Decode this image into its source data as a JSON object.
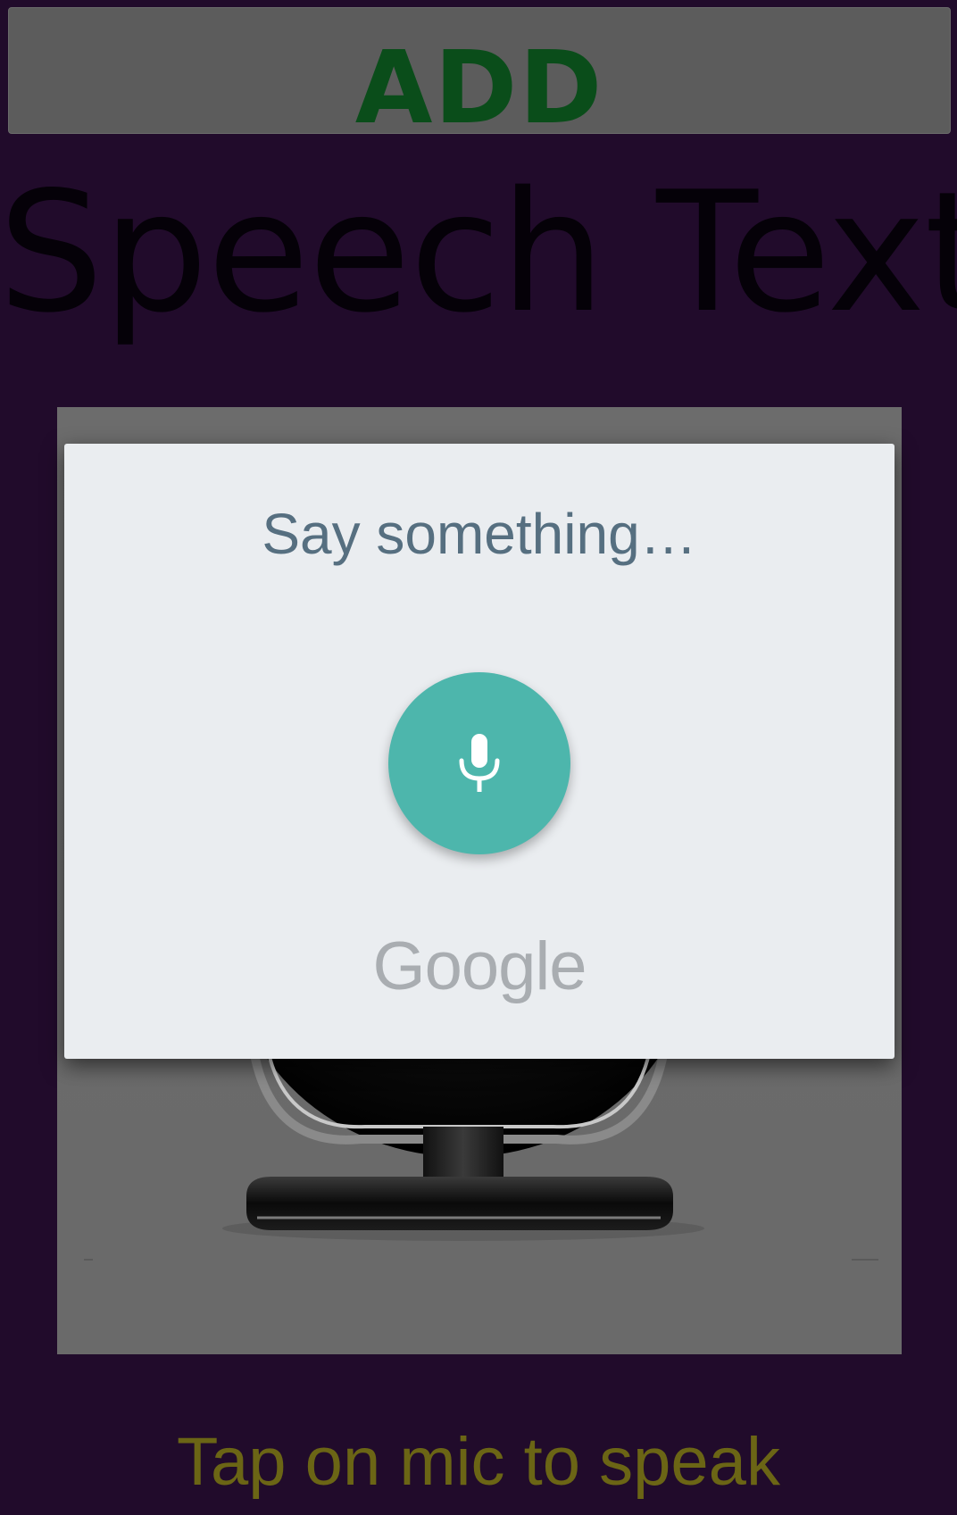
{
  "toolbar": {
    "add_label": "ADD"
  },
  "main": {
    "title": "Speech Text",
    "hint": "Tap on mic to speak",
    "mic_image_icon": "microphone-image"
  },
  "voice_dialog": {
    "prompt": "Say something…",
    "mic_icon": "mic-icon",
    "brand": "Google"
  },
  "colors": {
    "background": "#210b2b",
    "add_button_bg": "#5c5c5c",
    "add_label": "#0a4d1a",
    "title_text": "#050108",
    "dialog_bg": "#eaedf0",
    "prompt_text": "#566f80",
    "mic_button": "#4db6ac",
    "brand_text": "#a9adb1",
    "hint_text": "#6b6515"
  }
}
